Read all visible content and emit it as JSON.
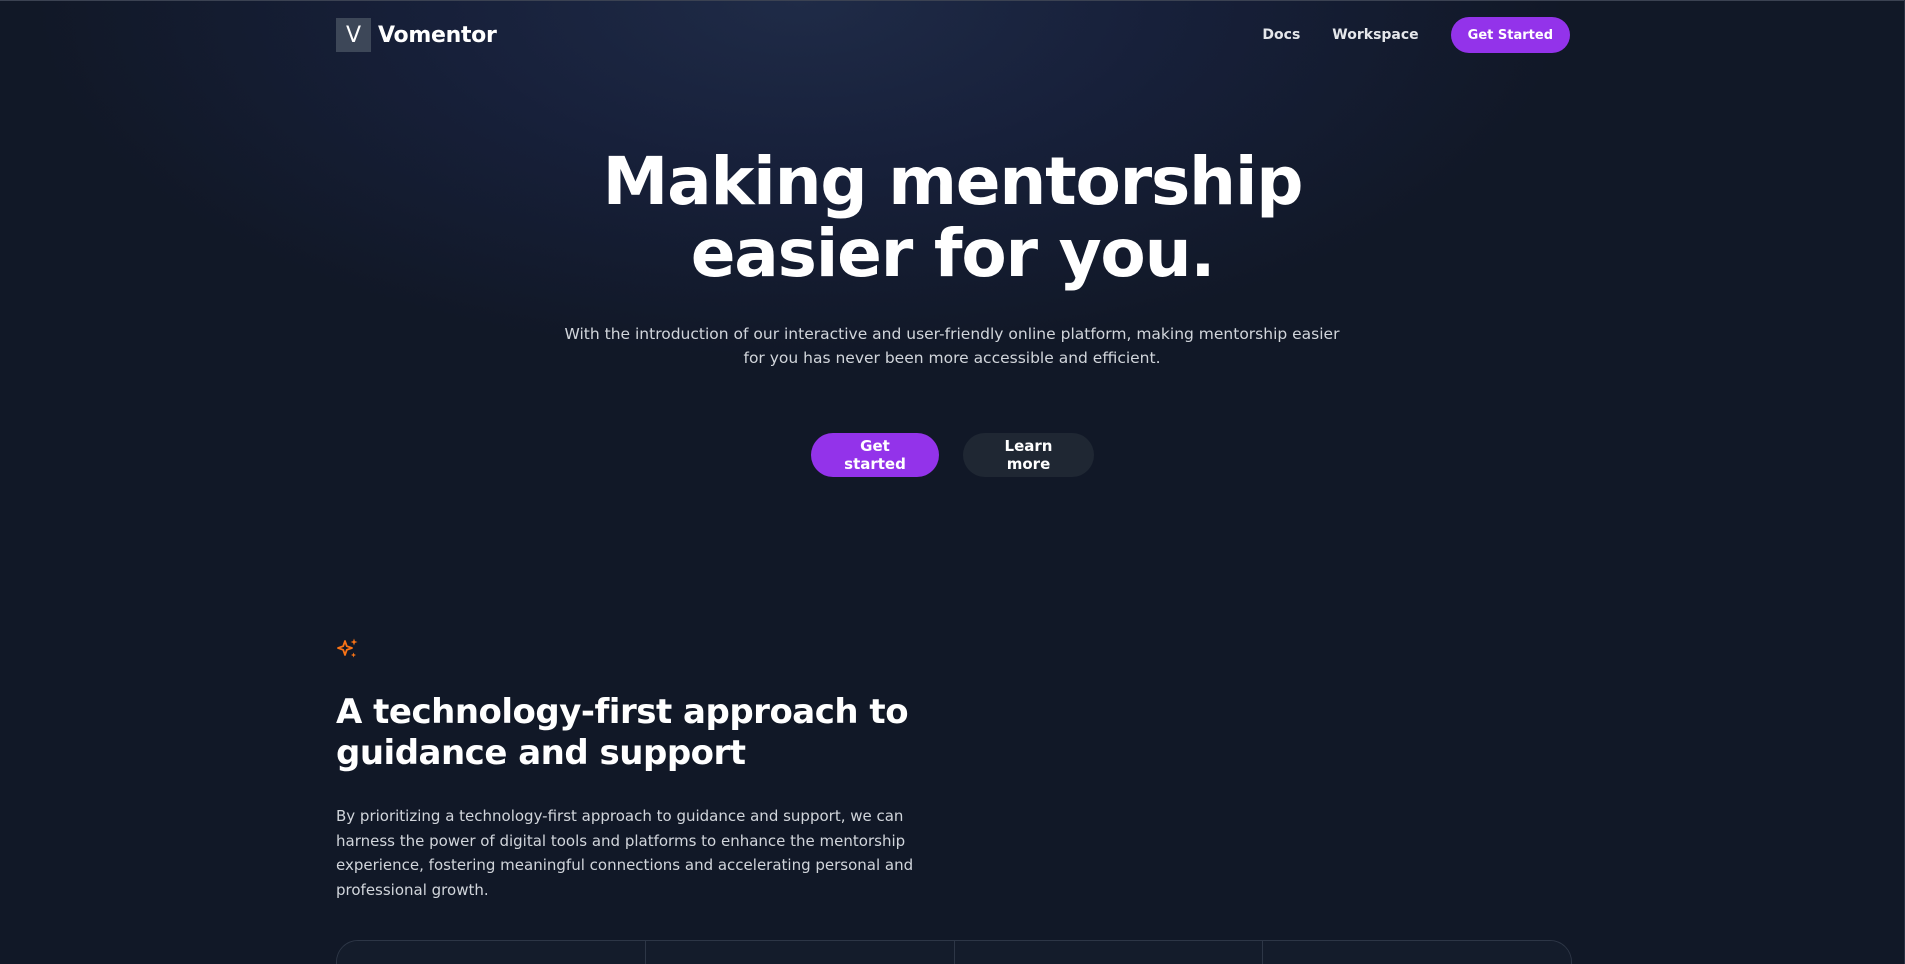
{
  "nav": {
    "logo_letter": "V",
    "brand_name": "Vomentor",
    "links": [
      {
        "label": "Docs"
      },
      {
        "label": "Workspace"
      }
    ],
    "cta_label": "Get Started"
  },
  "hero": {
    "title_line1": "Making mentorship",
    "title_line2": "easier for you.",
    "subtitle": "With the introduction of our interactive and user-friendly online platform, making mentorship easier for you has never been more accessible and efficient.",
    "primary_label": "Get started",
    "secondary_label": "Learn more"
  },
  "feature": {
    "icon": "sparkles-icon",
    "title_line1": "A technology-first approach to",
    "title_line2": "guidance and support",
    "body": "By prioritizing a technology-first approach to guidance and support, we can harness the power of digital tools and platforms to enhance the mentorship experience, fostering meaningful connections and accelerating personal and professional growth."
  },
  "colors": {
    "background": "#111827",
    "accent": "#9333ea",
    "secondary_button": "#1f2733",
    "sparkle": "#f97316"
  }
}
